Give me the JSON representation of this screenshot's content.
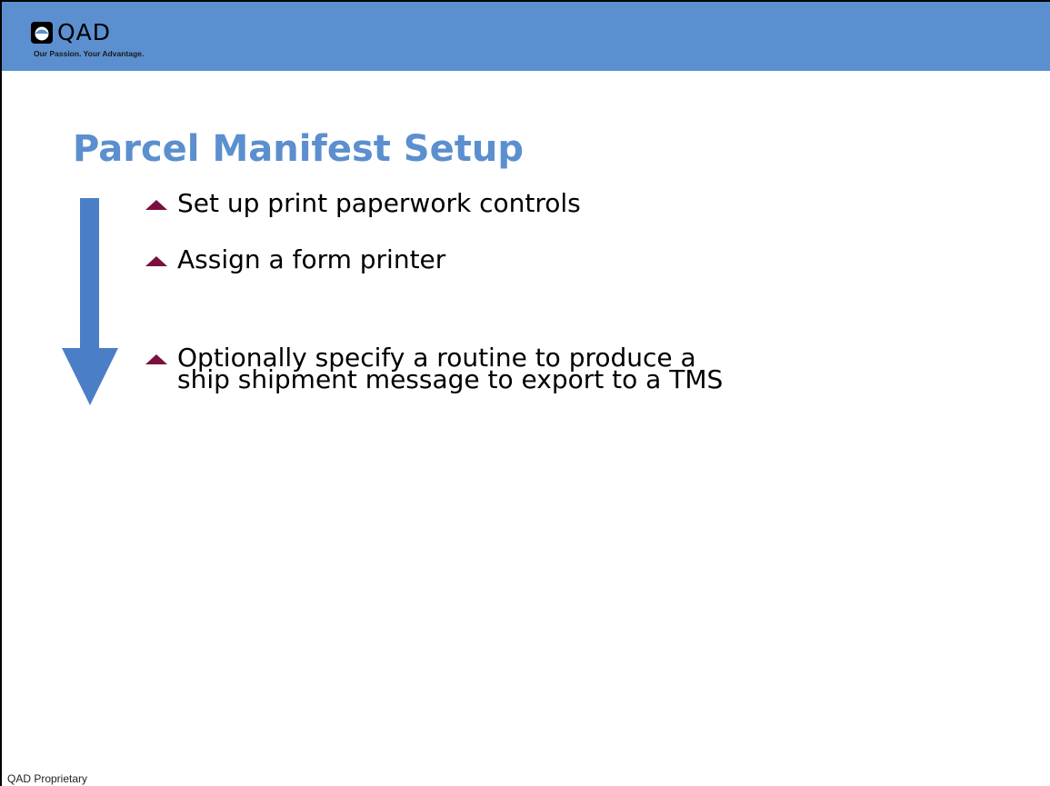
{
  "header": {
    "logo": {
      "wordmark": "QAD",
      "tagline": "Our Passion. Your Advantage."
    }
  },
  "slide": {
    "title": "Parcel Manifest Setup",
    "bullets": [
      {
        "text": "Set up print paperwork controls"
      },
      {
        "text": "Assign a form printer"
      },
      {
        "text": "Optionally specify a routine to produce a\nship shipment message to export to a TMS"
      }
    ]
  },
  "footer": {
    "text": "QAD Proprietary"
  },
  "colors": {
    "header_band": "#5b8fcf",
    "title": "#5b8fcf",
    "arrow": "#4a7fc8",
    "bullet_marker": "#7a1040"
  },
  "icons": {
    "logo_mark": "qad-globe-icon",
    "bullet_marker": "triangle-up-bullet-icon",
    "flow_arrow": "down-arrow-icon"
  }
}
